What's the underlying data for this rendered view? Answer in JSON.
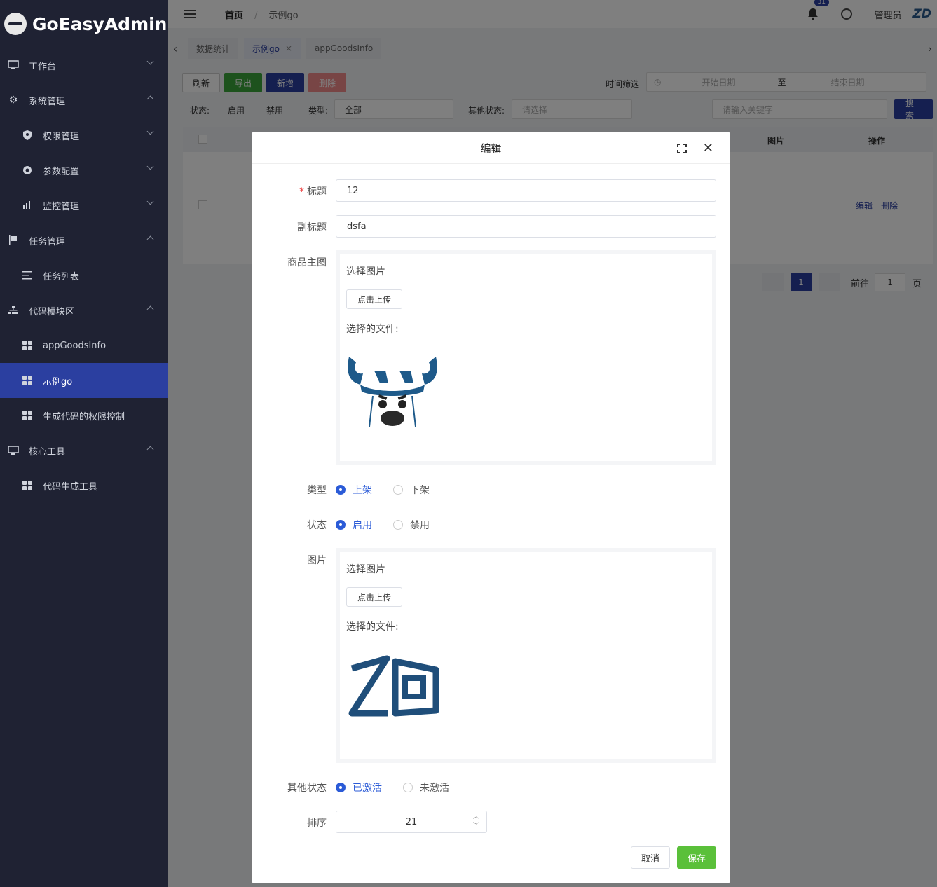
{
  "app": {
    "name": "GoEasyAdmin"
  },
  "sidebar": {
    "items": [
      {
        "label": "工作台",
        "icon": "monitor-icon"
      },
      {
        "label": "系统管理",
        "icon": "gear-icon"
      },
      {
        "label": "权限管理",
        "icon": "shield-icon"
      },
      {
        "label": "参数配置",
        "icon": "dot-circle-icon"
      },
      {
        "label": "监控管理",
        "icon": "bar-chart-icon"
      },
      {
        "label": "任务管理",
        "icon": "flag-icon"
      },
      {
        "label": "任务列表",
        "icon": "list-icon"
      },
      {
        "label": "代码模块区",
        "icon": "sitemap-icon"
      },
      {
        "label": "appGoodsInfo",
        "icon": "grid-icon"
      },
      {
        "label": "示例go",
        "icon": "grid-icon"
      },
      {
        "label": "生成代码的权限控制",
        "icon": "grid-icon"
      },
      {
        "label": "核心工具",
        "icon": "monitor-icon"
      },
      {
        "label": "代码生成工具",
        "icon": "grid-icon"
      }
    ]
  },
  "header": {
    "breadcrumb_home": "首页",
    "breadcrumb_sep": "/",
    "breadcrumb_current": "示例go",
    "notification_count": "31",
    "user": "管理员",
    "brand": "ZD"
  },
  "tabs": {
    "prev": "‹",
    "next": "›",
    "items": [
      {
        "label": "数据统计"
      },
      {
        "label": "示例go",
        "close": "×"
      },
      {
        "label": "appGoodsInfo"
      }
    ]
  },
  "toolbar": {
    "refresh": "刷新",
    "export": "导出",
    "add": "新增",
    "delete": "删除",
    "time_filter": "时间筛选",
    "start_date": "开始日期",
    "to": "至",
    "end_date": "结束日期"
  },
  "filters": {
    "status_label": "状态:",
    "status_on": "启用",
    "status_off": "禁用",
    "type_label": "类型:",
    "type_value": "全部",
    "other_label": "其他状态:",
    "other_placeholder": "请选择",
    "keyword_placeholder": "请输入关键字",
    "search": "搜索"
  },
  "table": {
    "col_image": "图片",
    "col_ops": "操作",
    "edit": "编辑",
    "delete": "删除"
  },
  "pager": {
    "current": "1",
    "goto": "前往",
    "goto_value": "1",
    "page_suffix": "页"
  },
  "modal": {
    "title": "编辑",
    "title_label": "标题",
    "title_value": "12",
    "subtitle_label": "副标题",
    "subtitle_value": "dsfa",
    "main_image_label": "商品主图",
    "select_image": "选择图片",
    "upload_btn": "点击上传",
    "selected_file": "选择的文件:",
    "type_label": "类型",
    "type_opt1": "上架",
    "type_opt2": "下架",
    "status_label": "状态",
    "status_opt1": "启用",
    "status_opt2": "禁用",
    "image_label": "图片",
    "other_label": "其他状态",
    "other_opt1": "已激活",
    "other_opt2": "未激活",
    "sort_label": "排序",
    "sort_value": "21",
    "cancel": "取消",
    "save": "保存"
  }
}
